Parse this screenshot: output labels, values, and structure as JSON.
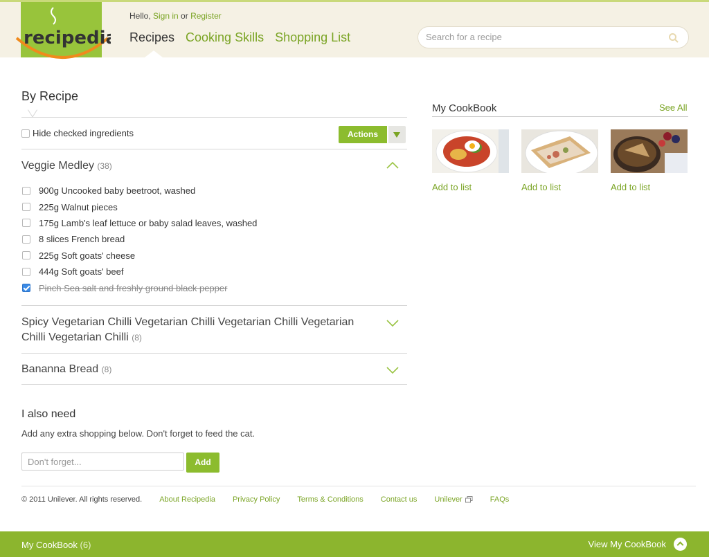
{
  "header": {
    "logo_text": "recipedia",
    "greeting_prefix": "Hello, ",
    "sign_in": "Sign in",
    "greeting_or": " or ",
    "register": "Register",
    "nav": [
      "Recipes",
      "Cooking Skills",
      "Shopping List"
    ],
    "active_nav": "Recipes",
    "search_placeholder": "Search for a recipe"
  },
  "list": {
    "heading": "By Recipe",
    "hide_checked_label": "Hide checked ingredients",
    "hide_checked": false,
    "actions_label": "Actions",
    "recipes": [
      {
        "title": "Veggie Medley",
        "count": "(38)",
        "expanded": true,
        "ingredients": [
          {
            "text": "900g Uncooked baby beetroot, washed",
            "checked": false
          },
          {
            "text": "225g Walnut pieces",
            "checked": false
          },
          {
            "text": "175g Lamb's leaf lettuce or baby salad leaves, washed",
            "checked": false
          },
          {
            "text": "8 slices French bread",
            "checked": false
          },
          {
            "text": "225g Soft goats' cheese",
            "checked": false
          },
          {
            "text": "444g Soft goats' beef",
            "checked": false
          },
          {
            "text": "Pinch Sea salt and freshly ground black pepper",
            "checked": true
          }
        ]
      },
      {
        "title_line1": "Spicy Vegetarian Chilli Vegetarian Chilli Vegetarian Chilli Vegetarian",
        "title_line2": "Chilli Vegetarian Chilli",
        "count": "(8)",
        "expanded": false
      },
      {
        "title": "Bananna Bread",
        "count": "(8)",
        "expanded": false
      }
    ]
  },
  "also_need": {
    "title": "I also need",
    "subtitle": "Add any extra shopping below. Don't forget to feed the cat.",
    "input_placeholder": "Don't forget...",
    "add_label": "Add"
  },
  "cookbook": {
    "title": "My CookBook",
    "see_all": "See All",
    "add_to_list": "Add to list",
    "items": [
      "egg-salad-dish",
      "sandwich-dish",
      "pie-with-berries-dish"
    ]
  },
  "footer": {
    "copyright": "© 2011 Unilever. All rights reserved.",
    "links": [
      "About Recipedia",
      "Privacy Policy",
      "Terms & Conditions",
      "Contact us",
      "Unilever",
      "FAQs"
    ]
  },
  "bottom_bar": {
    "label": "My CookBook",
    "count": "(6)",
    "view_label": "View My CookBook"
  },
  "colors": {
    "brand_green": "#8cbc2e",
    "link_green": "#7aa424",
    "header_bg": "#f5f1e4",
    "logo_orange": "#f08a1c"
  }
}
